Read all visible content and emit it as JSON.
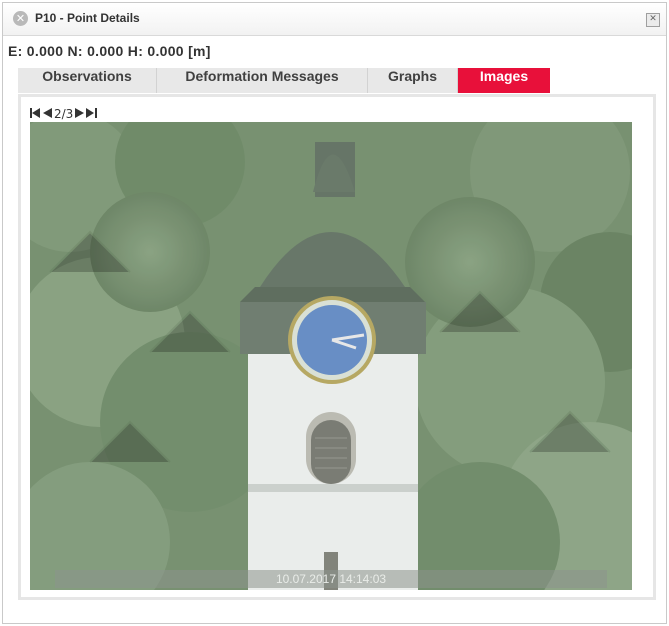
{
  "window": {
    "title": "P10 - Point Details",
    "title_icon": "close-circle-icon",
    "close_icon": "close-icon"
  },
  "coordinates": "E: 0.000 N: 0.000 H: 0.000 [m]",
  "tabs": [
    {
      "label": "Observations",
      "active": false
    },
    {
      "label": "Deformation Messages",
      "active": false
    },
    {
      "label": "Graphs",
      "active": false
    },
    {
      "label": "Images",
      "active": true
    }
  ],
  "image_nav": {
    "counter": "2/3",
    "first_icon": "first-page-icon",
    "prev_icon": "previous-icon",
    "next_icon": "next-icon",
    "last_icon": "last-page-icon"
  },
  "image": {
    "timestamp": "10.07.2017 14:14:03",
    "subject": "clock-tower-photo"
  },
  "colors": {
    "active_tab": "#e8103a",
    "tab_bg": "#e8e8e8",
    "foliage": "#6f8a68",
    "clock_face": "#5f87c2"
  }
}
